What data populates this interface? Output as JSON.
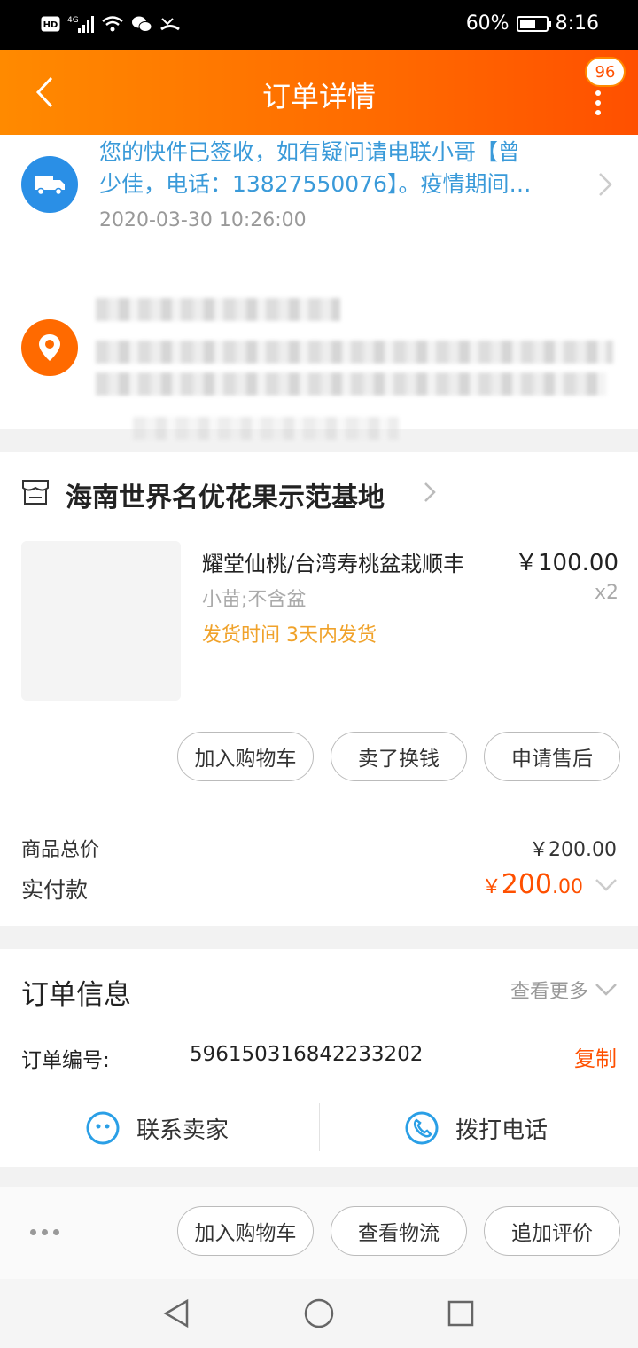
{
  "status_bar": {
    "hd_label": "HD",
    "net_label": "4G",
    "battery_percent": "60%",
    "battery_level": 0.6,
    "time": "8:16"
  },
  "header": {
    "title": "订单详情",
    "back_icon": "chevron-left-icon",
    "more_icon": "more-vertical-icon",
    "badge_count": "96"
  },
  "logistics": {
    "icon": "truck-icon",
    "message_line1": "您的快件已签收，如有疑问请电联小哥【曾",
    "message_line2": "少佳，电话：13827550076】。疫情期间…",
    "time": "2020-03-30 10:26:00"
  },
  "address": {
    "icon": "location-pin-icon"
  },
  "shop": {
    "icon": "store-icon",
    "name": "海南世界名优花果示范基地"
  },
  "product": {
    "title": "耀堂仙桃/台湾寿桃盆栽顺丰",
    "price": "￥100.00",
    "sku": "小苗;不含盆",
    "quantity": "x2",
    "shipping": "发货时间 3天内发货",
    "actions": [
      "加入购物车",
      "卖了换钱",
      "申请售后"
    ]
  },
  "summary": {
    "total_label": "商品总价",
    "total_value": "￥200.00",
    "paid_label": "实付款",
    "paid_currency": "￥",
    "paid_integer": "200",
    "paid_decimal": ".00"
  },
  "order_info": {
    "title": "订单信息",
    "more_label": "查看更多",
    "order_no_label": "订单编号:",
    "order_no_value": "596150316842233202",
    "copy_label": "复制",
    "contact_seller": "联系卖家",
    "call_phone": "拨打电话"
  },
  "bottom_bar": {
    "buttons": [
      "加入购物车",
      "查看物流",
      "追加评价"
    ]
  },
  "colors": {
    "accent": "#ff5000",
    "header_start": "#ff8a00",
    "link_blue": "#3a9ad9",
    "shipping_orange": "#f0a22a"
  }
}
